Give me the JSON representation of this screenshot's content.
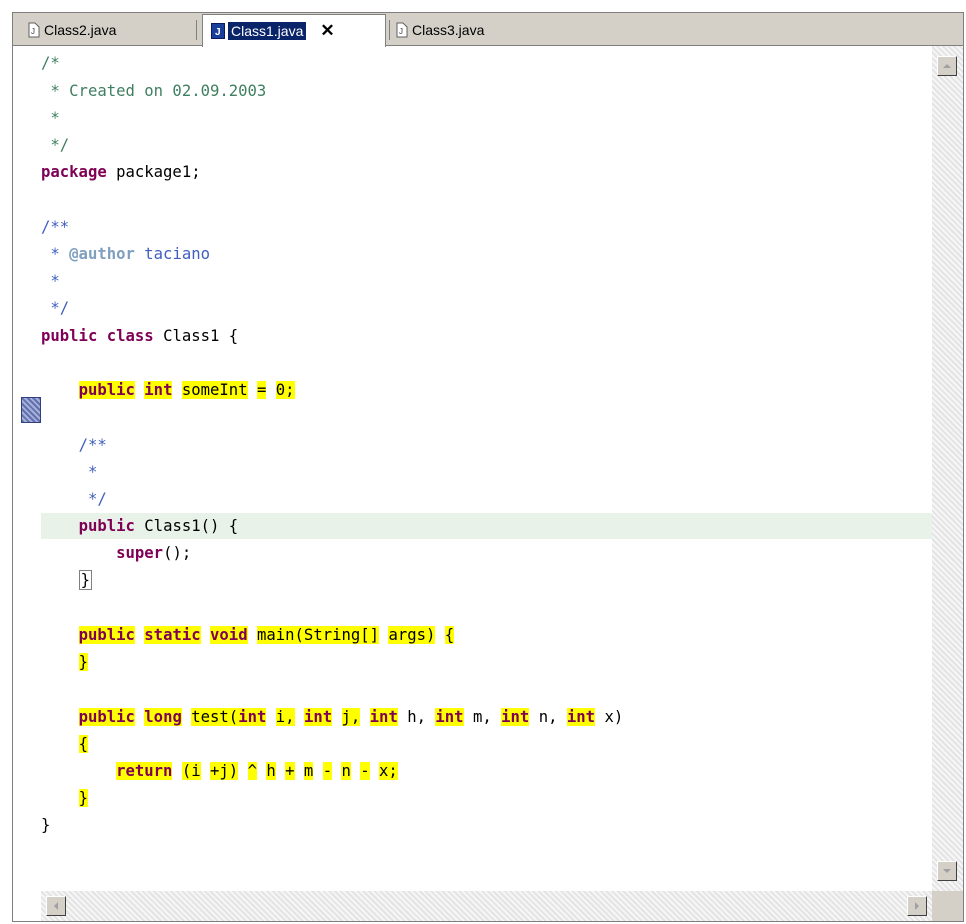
{
  "tabs": [
    {
      "label": "Class2.java",
      "icon": "java-file-icon",
      "active": false
    },
    {
      "label": "Class1.java",
      "icon": "java-file-icon",
      "active": true
    },
    {
      "label": "Class3.java",
      "icon": "java-file-icon",
      "active": false
    }
  ],
  "close_label": "✕",
  "code": {
    "c1": "/*",
    "c2": " * Created on 02.09.2003",
    "c3": " *",
    "c4": " */",
    "pkg_kw": "package",
    "pkg_name": " package1;",
    "d1": "/**",
    "d2_star": " * ",
    "d2_tag": "@author",
    "d2_text": " taciano",
    "d3": " *",
    "d4": " */",
    "cls_kw1": "public",
    "cls_kw2": "class",
    "cls_rest": " Class1 {",
    "f_kw1": "public",
    "f_kw2": "int",
    "f_name": "someInt",
    "f_eq": "=",
    "f_val": "0;",
    "e1": "/**",
    "e2": " *",
    "e3": " */",
    "ctor_kw": "public",
    "ctor_rest": " Class1() {",
    "super_kw": "super",
    "super_rest": "();",
    "ctor_close": "}",
    "m_kw1": "public",
    "m_kw2": "static",
    "m_kw3": "void",
    "m_sig": "main(String[]",
    "m_args": "args)",
    "m_open": "{",
    "m_close": "}",
    "t_kw1": "public",
    "t_kw2": "long",
    "t_sig": "test(int",
    "t_int": "int",
    "t_i": "i,",
    "t_j": "j,",
    "t_h": "h,",
    "t_m": "m,",
    "t_n": "n,",
    "t_x": "x)",
    "t_open": "{",
    "r_kw": "return",
    "r_a": "(i",
    "r_b": "+j)",
    "r_c": "^",
    "r_d": "h",
    "r_plus": "+",
    "r_m": "m",
    "r_minus": "-",
    "r_n": "n",
    "r_x": "x;",
    "t_close": "}",
    "cls_close": "}"
  }
}
